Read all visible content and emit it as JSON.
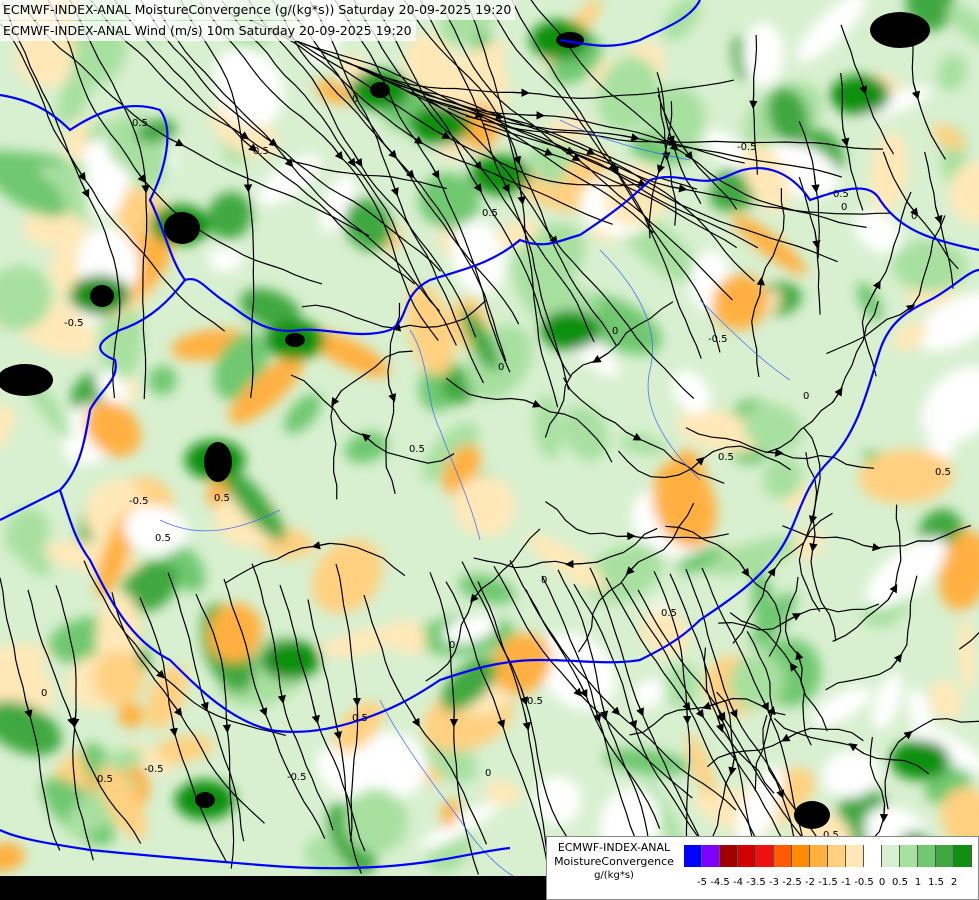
{
  "header": {
    "line1": "ECMWF-INDEX-ANAL MoistureConvergence (g/(kg*s)) Saturday 20-09-2025 19:20",
    "line2": "ECMWF-INDEX-ANAL Wind (m/s) 10m Saturday 20-09-2025 19:20"
  },
  "legend": {
    "title1": "ECMWF-INDEX-ANAL",
    "title2": "MoistureConvergence",
    "unit": "g/(kg*s)",
    "colors": [
      "#0000ff",
      "#8000ff",
      "#a00000",
      "#d00000",
      "#f01010",
      "#ff5a00",
      "#ff8c00",
      "#ffb040",
      "#ffd080",
      "#ffe8b8",
      "#ffffff",
      "#d8f0d0",
      "#a8e0a0",
      "#70c870",
      "#40a840",
      "#109010"
    ],
    "ticks": [
      "-5",
      "-4.5",
      "-4",
      "-3.5",
      "-3",
      "-2.5",
      "-2",
      "-1.5",
      "-1",
      "-0.5",
      "0",
      "0.5",
      "1",
      "1.5",
      "2"
    ]
  },
  "map": {
    "contour_labels": [
      "0.5",
      "0",
      "-0.5",
      "0",
      "0.5",
      "0",
      "-0.5",
      "0.5",
      "0",
      "0.5",
      "-0.5",
      "0.5",
      "0",
      "0.5",
      "0",
      "-0.5",
      "0.5",
      "0",
      "0.5",
      "0.5",
      "0",
      "0.5",
      "-0.5",
      "0",
      "0.5",
      "0.5",
      "0",
      "0.5",
      "0.5",
      "-0.5"
    ],
    "colors": {
      "green_light": "#d8f0d0",
      "green_mid": "#a8e0a0",
      "green": "#70c870",
      "green_dark": "#40a840",
      "green_darkest": "#109010",
      "orange_light": "#ffe8b8",
      "orange": "#ffd080",
      "orange_mid": "#ffb040",
      "orange_dark": "#ff8c00",
      "black_patch": "#000000",
      "border": "#0000ff",
      "river": "#3060ff",
      "streamline": "#000000"
    }
  }
}
